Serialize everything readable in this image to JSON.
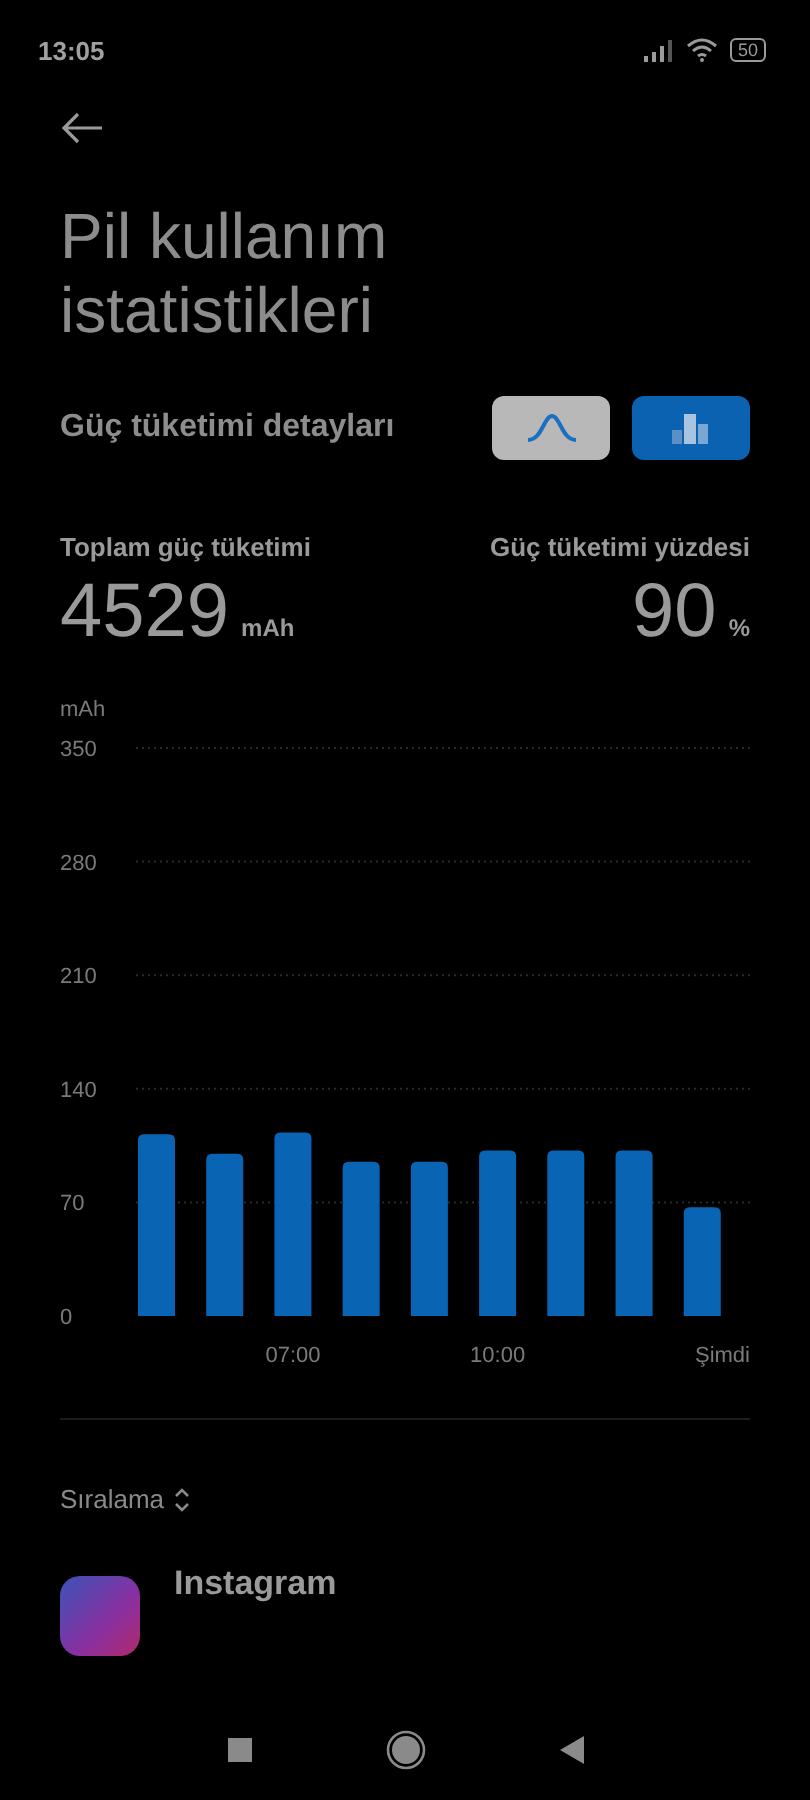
{
  "status_bar": {
    "time": "13:05",
    "battery": "50"
  },
  "title": "Pil kullanım istatistikleri",
  "details": {
    "heading": "Güç tüketimi detayları",
    "chart_types": [
      {
        "kind": "line",
        "selected": false
      },
      {
        "kind": "bar",
        "selected": true
      }
    ]
  },
  "stats": [
    {
      "label": "Toplam güç tüketimi",
      "value": "4529",
      "unit": "mAh"
    },
    {
      "label": "Güç tüketimi yüzdesi",
      "value": "90",
      "unit": "%"
    }
  ],
  "chart": {
    "chart_data": {
      "type": "bar",
      "ylabel": "mAh",
      "categories": [
        null,
        null,
        "07:00",
        null,
        null,
        "10:00",
        null,
        null,
        "Şimdi"
      ],
      "series": [
        {
          "color": "#0a64b4",
          "values": [
            112,
            100,
            113,
            95,
            95,
            102,
            102,
            102,
            67
          ]
        }
      ],
      "ylim": [
        0,
        350
      ],
      "grid": true,
      "yticks": [
        0,
        70,
        140,
        210,
        280,
        350
      ]
    }
  },
  "sort": {
    "label": "Sıralama"
  },
  "apps": [
    {
      "name": "Instagram"
    }
  ]
}
